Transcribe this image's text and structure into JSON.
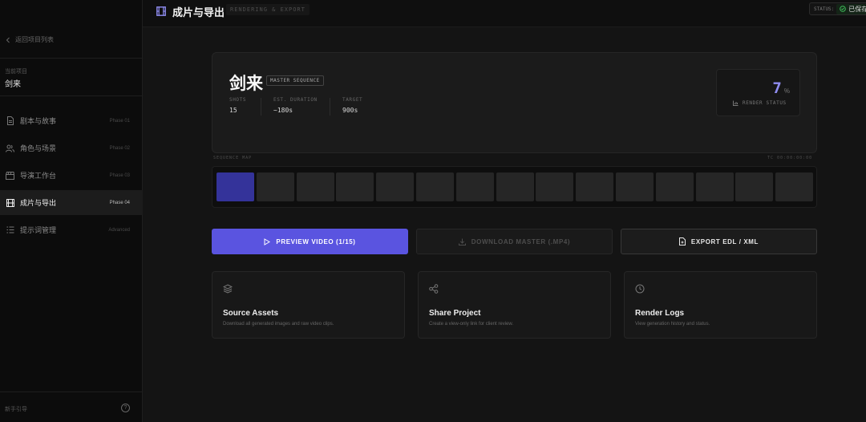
{
  "sidebar": {
    "back_label": "返回项目列表",
    "project_label": "当前项目",
    "project_name": "剑来",
    "items": [
      {
        "label": "剧本与故事",
        "phase": "Phase 01"
      },
      {
        "label": "角色与场景",
        "phase": "Phase 02"
      },
      {
        "label": "导演工作台",
        "phase": "Phase 03"
      },
      {
        "label": "成片与导出",
        "phase": "Phase 04"
      },
      {
        "label": "提示词管理",
        "phase": "Advanced"
      }
    ],
    "active_index": 3,
    "help_label": "新手引导",
    "help_glyph": "?"
  },
  "topbar": {
    "title": "成片与导出",
    "subtitle": "RENDERING & EXPORT",
    "status_key": "STATUS:",
    "status_value": "已保存"
  },
  "hero": {
    "title": "剑来",
    "tag": "MASTER SEQUENCE",
    "stats": [
      {
        "label": "SHOTS",
        "value": "15"
      },
      {
        "label": "EST. DURATION",
        "value": "~180s"
      },
      {
        "label": "TARGET",
        "value": "900s"
      }
    ],
    "render_value": "7",
    "render_unit": "%",
    "render_label": "RENDER STATUS"
  },
  "sequence": {
    "label": "SEQUENCE MAP",
    "timecode": "TC 00:00:00:00",
    "shot_count": 15,
    "active_shot": 0
  },
  "actions": {
    "preview": "PREVIEW VIDEO (1/15)",
    "download": "DOWNLOAD MASTER (.MP4)",
    "export": "EXPORT EDL / XML"
  },
  "cards": [
    {
      "title": "Source Assets",
      "desc": "Download all generated images and raw video clips.",
      "icon": "layers-icon"
    },
    {
      "title": "Share Project",
      "desc": "Create a view-only link for client review.",
      "icon": "share-icon"
    },
    {
      "title": "Render Logs",
      "desc": "View generation history and status.",
      "icon": "clock-icon"
    }
  ],
  "colors": {
    "accent": "#5a54e0",
    "render_value": "#8f8cf0",
    "active_shot": "#34339a",
    "saved": "#3fbf5a"
  }
}
